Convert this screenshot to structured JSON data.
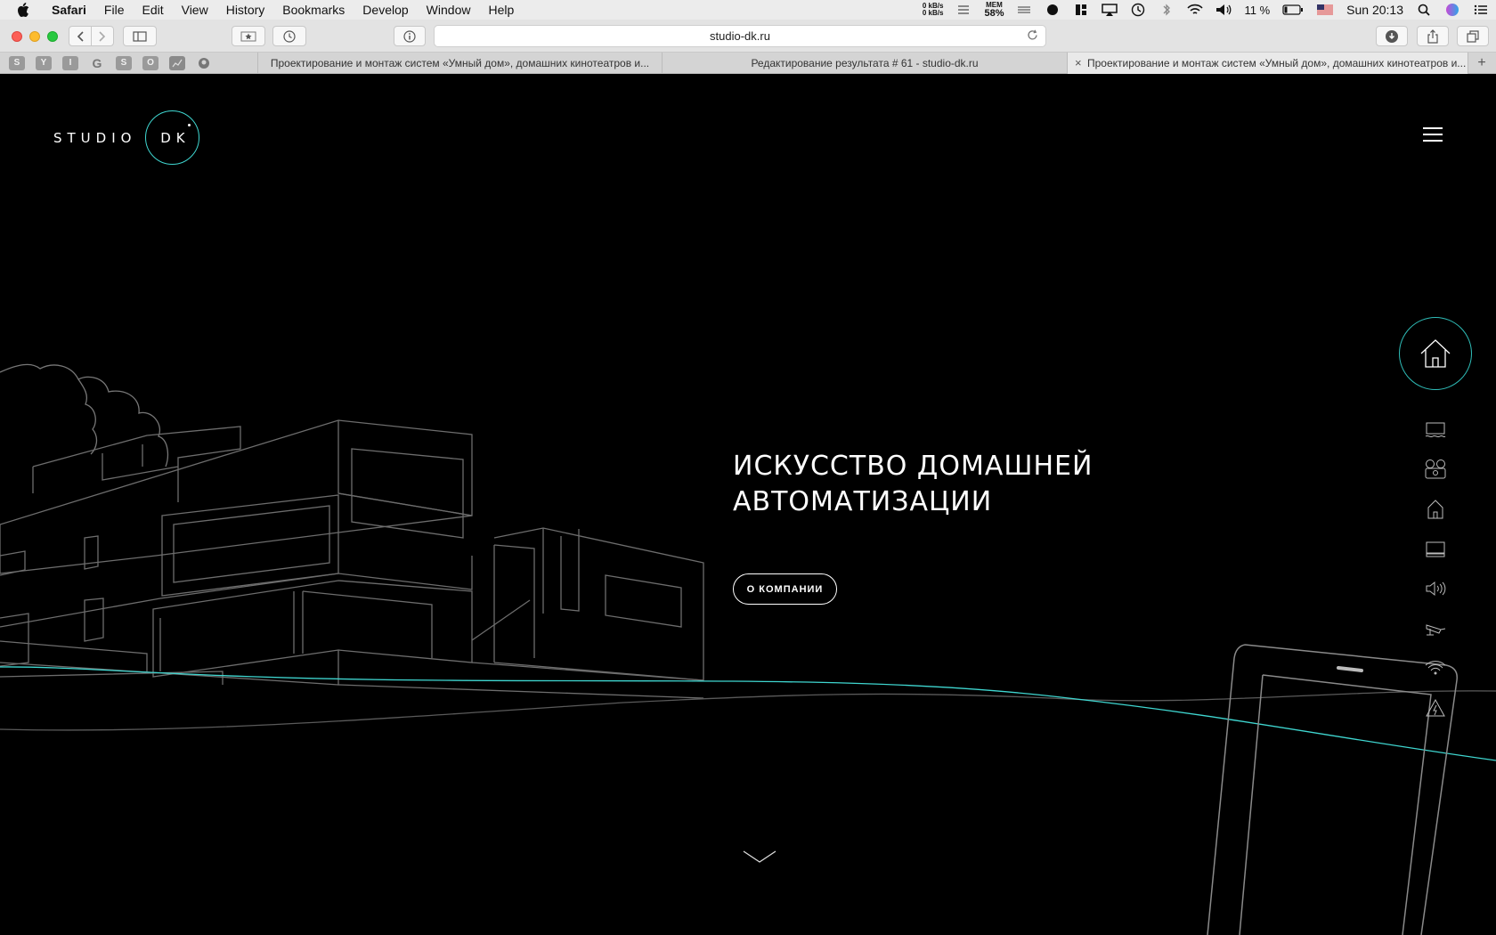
{
  "menubar": {
    "app_name": "Safari",
    "items": [
      "File",
      "Edit",
      "View",
      "History",
      "Bookmarks",
      "Develop",
      "Window",
      "Help"
    ],
    "net_up": "0 kB/s",
    "net_down": "0 kB/s",
    "mem_label": "MEM",
    "mem_value": "58%",
    "battery": "11 %",
    "clock": "Sun 20:13"
  },
  "toolbar": {
    "url": "studio-dk.ru"
  },
  "tabs": {
    "pinned": [
      "S",
      "Y",
      "I",
      "G",
      "S",
      "O",
      "",
      ""
    ],
    "items": [
      {
        "title": "Проектирование и монтаж систем «Умный дом», домашних кинотеатров и..."
      },
      {
        "title": "Редактирование результата # 61 - studio-dk.ru"
      },
      {
        "title": "Проектирование и монтаж систем «Умный дом», домашних кинотеатров и..."
      }
    ]
  },
  "page": {
    "logo_left": "STUDIO",
    "logo_right": "DK",
    "headline_line1": "ИСКУССТВО ДОМАШНЕЙ",
    "headline_line2": "АВТОМАТИЗАЦИИ",
    "cta_label": "О КОМПАНИИ",
    "accent_color": "#3fd6d0"
  },
  "side_nav": {
    "icons": [
      "home-icon",
      "cinema-screen-icon",
      "projector-icon",
      "smart-house-icon",
      "tv-icon",
      "speaker-icon",
      "camera-icon",
      "wifi-icon",
      "electricity-icon"
    ]
  }
}
